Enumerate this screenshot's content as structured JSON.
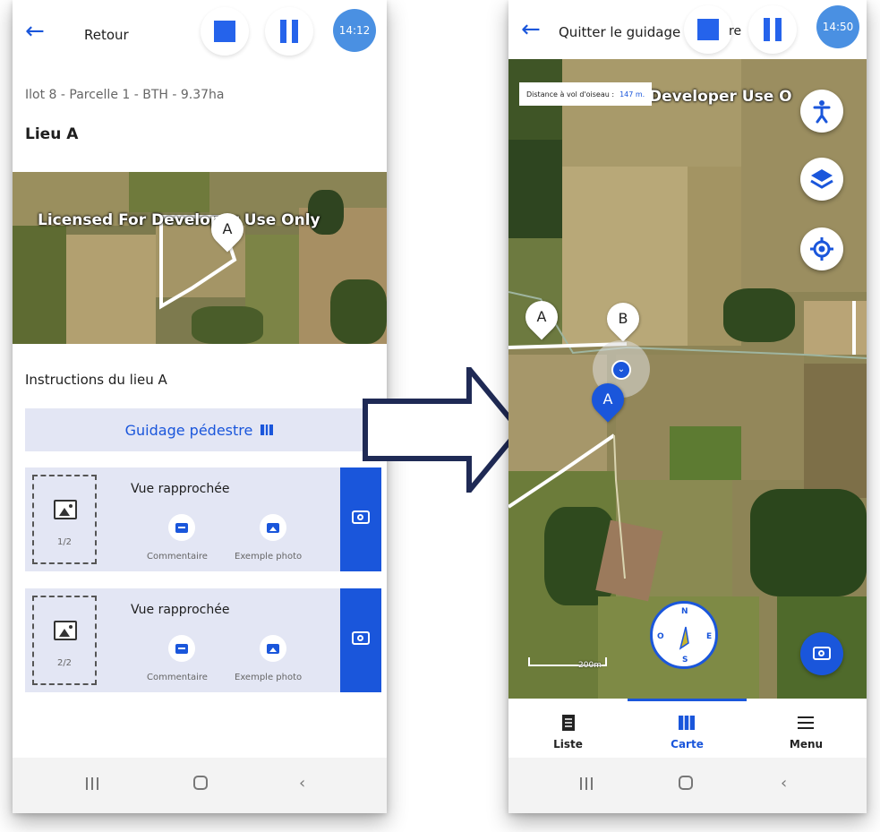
{
  "left_screen": {
    "topbar": {
      "back_label": "Retour",
      "time": "14:12"
    },
    "parcel_info": "Ilot 8 - Parcelle 1 - BTH - 9.37ha",
    "place_title": "Lieu A",
    "map": {
      "watermark": "Licensed For Developer Use Only",
      "marker": "A"
    },
    "instructions_title": "Instructions du lieu A",
    "guidance_button": "Guidage pédestre",
    "cards": [
      {
        "title": "Vue rapprochée",
        "count": "1/2",
        "comment_label": "Commentaire",
        "example_label": "Exemple photo"
      },
      {
        "title": "Vue rapprochée",
        "count": "2/2",
        "comment_label": "Commentaire",
        "example_label": "Exemple photo"
      }
    ]
  },
  "right_screen": {
    "topbar": {
      "quit_label": "Quitter le guidage",
      "partial_text": "re",
      "time": "14:50"
    },
    "distance_label": "Distance à vol d'oiseau :",
    "distance_value": "147 m.",
    "watermark": "Licensed For Developer Use O",
    "markers": [
      "A",
      "B",
      "A"
    ],
    "scale_label": "200m",
    "compass": {
      "n": "N",
      "s": "S",
      "e": "E",
      "o": "O"
    },
    "tabs": [
      {
        "label": "Liste",
        "active": false
      },
      {
        "label": "Carte",
        "active": true
      },
      {
        "label": "Menu",
        "active": false
      }
    ]
  },
  "colors": {
    "primary": "#1a56db",
    "badge": "#4a90e2",
    "card_bg": "#e3e6f4",
    "arrow_outline": "#1f2a55"
  }
}
